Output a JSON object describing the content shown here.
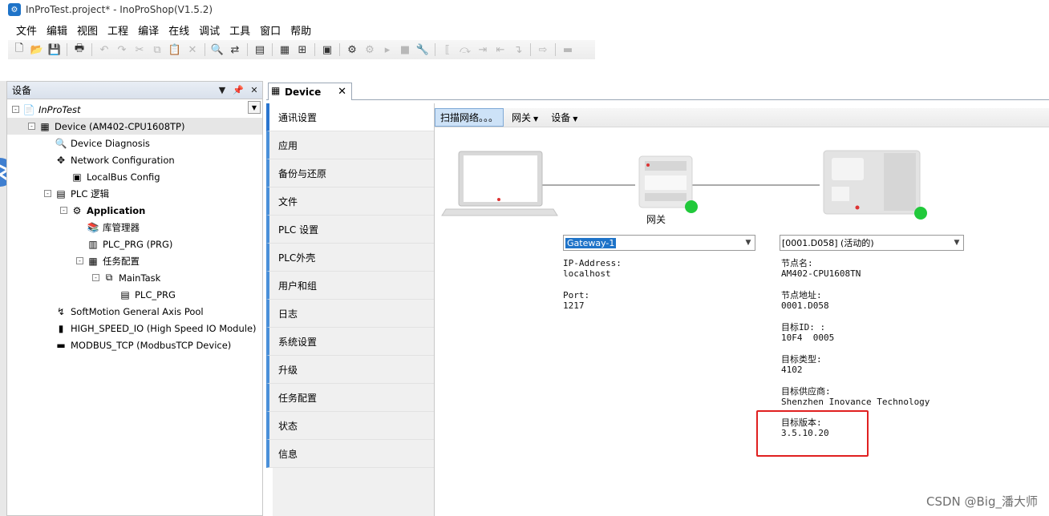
{
  "window": {
    "title": "InProTest.project* - InoProShop(V1.5.2)",
    "app_icon": "inoproshop-icon"
  },
  "menu": [
    "文件",
    "编辑",
    "视图",
    "工程",
    "编译",
    "在线",
    "调试",
    "工具",
    "窗口",
    "帮助"
  ],
  "devices_panel": {
    "title": "设备",
    "tree": [
      {
        "label": "InProTest",
        "icon": "project-icon",
        "depth": 0,
        "expander": "-",
        "style": "italic"
      },
      {
        "label": "Device (AM402-CPU1608TP)",
        "icon": "device-icon",
        "depth": 1,
        "expander": "-",
        "style": "selected"
      },
      {
        "label": "Device Diagnosis",
        "icon": "diagnosis-icon",
        "depth": 2,
        "expander": ""
      },
      {
        "label": "Network Configuration",
        "icon": "network-icon",
        "depth": 2,
        "expander": ""
      },
      {
        "label": "LocalBus Config",
        "icon": "localbus-icon",
        "depth": 3,
        "expander": ""
      },
      {
        "label": "PLC 逻辑",
        "icon": "plc-logic-icon",
        "depth": 2,
        "expander": "-"
      },
      {
        "label": "Application",
        "icon": "application-icon",
        "depth": 3,
        "expander": "-",
        "style": "bold"
      },
      {
        "label": "库管理器",
        "icon": "library-icon",
        "depth": 4,
        "expander": ""
      },
      {
        "label": "PLC_PRG (PRG)",
        "icon": "program-icon",
        "depth": 4,
        "expander": ""
      },
      {
        "label": "任务配置",
        "icon": "task-config-icon",
        "depth": 4,
        "expander": "-"
      },
      {
        "label": "MainTask",
        "icon": "task-icon",
        "depth": 5,
        "expander": "-"
      },
      {
        "label": "PLC_PRG",
        "icon": "program-call-icon",
        "depth": 6,
        "expander": ""
      },
      {
        "label": "SoftMotion General Axis Pool",
        "icon": "axis-pool-icon",
        "depth": 2,
        "expander": ""
      },
      {
        "label": "HIGH_SPEED_IO (High Speed IO Module)",
        "icon": "io-module-icon",
        "depth": 2,
        "expander": ""
      },
      {
        "label": "MODBUS_TCP (ModbusTCP Device)",
        "icon": "modbus-icon",
        "depth": 2,
        "expander": ""
      }
    ]
  },
  "editor": {
    "tab_label": "Device",
    "nav": [
      "通讯设置",
      "应用",
      "备份与还原",
      "文件",
      "PLC 设置",
      "PLC外壳",
      "用户和组",
      "日志",
      "系统设置",
      "升级",
      "任务配置",
      "状态",
      "信息"
    ],
    "active_nav": 0,
    "toolbar": {
      "scan": "扫描网络。。。",
      "gateway": "网关",
      "device": "设备"
    },
    "gateway_caption": "网关",
    "gateway_combo": "Gateway-1",
    "device_combo": "[0001.D058] (活动的)",
    "gateway_info": {
      "ip_label": "IP-Address:",
      "ip_value": "localhost",
      "port_label": "Port:",
      "port_value": "1217"
    },
    "device_info": {
      "node_name_label": "节点名:",
      "node_name_value": "AM402-CPU1608TN",
      "node_addr_label": "节点地址:",
      "node_addr_value": "0001.D058",
      "target_id_label": "目标ID: :",
      "target_id_value": "10F4  0005",
      "target_type_label": "目标类型:",
      "target_type_value": "4102",
      "vendor_label": "目标供应商:",
      "vendor_value": "Shenzhen Inovance Technology",
      "version_label": "目标版本:",
      "version_value": "3.5.10.20"
    }
  },
  "watermark": "CSDN @Big_潘大师",
  "colors": {
    "accent": "#2a75cf",
    "highlight": "#e02020",
    "status_ok": "#21c93b"
  }
}
